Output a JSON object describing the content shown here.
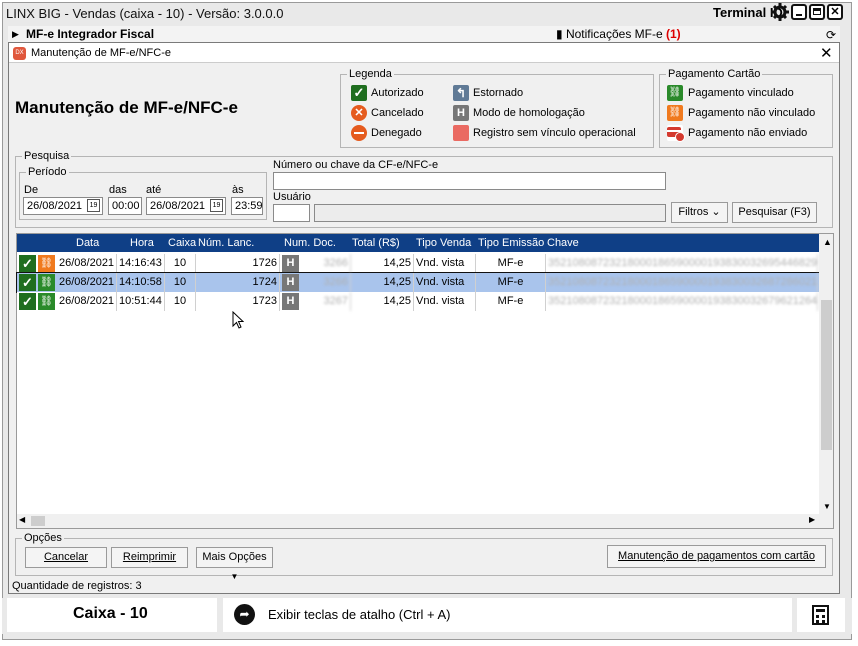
{
  "app": {
    "title": "LINX BIG - Vendas (caixa - 10) - Versão: 3.0.0.0",
    "terminal_label": "Terminal ID: 1"
  },
  "band": {
    "left_label": "MF-e Integrador Fiscal",
    "right_label": "Notificações MF-e",
    "right_count": "(1)"
  },
  "dialog": {
    "logo_text": "DX",
    "title": "Manutenção de MF-e/NFC-e",
    "heading": "Manutenção de MF-e/NFC-e"
  },
  "legenda": {
    "title": "Legenda",
    "items": [
      "Autorizado",
      "Cancelado",
      "Denegado",
      "Estornado",
      "Modo de homologação",
      "Registro sem vínculo operacional"
    ]
  },
  "pagamento": {
    "title": "Pagamento Cartão",
    "items": [
      "Pagamento vinculado",
      "Pagamento não vinculado",
      "Pagamento não enviado"
    ]
  },
  "pesquisa": {
    "title": "Pesquisa",
    "periodo_title": "Período",
    "de_label": "De",
    "das_label": "das",
    "ate_label": "até",
    "as_label": "às",
    "de_date": "26/08/2021",
    "das_time": "00:00",
    "ate_date": "26/08/2021",
    "as_time": "23:59",
    "numero_label": "Número ou chave da CF-e/NFC-e",
    "numero_value": "",
    "usuario_label": "Usuário",
    "usuario_code": "",
    "usuario_name": "",
    "filtros_label": "Filtros",
    "pesquisar_label": "Pesquisar (F3)"
  },
  "grid": {
    "columns": [
      "Data",
      "Hora",
      "Caixa",
      "Núm. Lanc.",
      "Num. Doc.",
      "Total (R$)",
      "Tipo Venda",
      "Tipo Emissão",
      "Chave"
    ],
    "rows": [
      {
        "data": "26/08/2021",
        "hora": "14:16:43",
        "caixa": "10",
        "lanc": "1726",
        "doc": "3266",
        "total": "14,25",
        "venda": "Vnd. vista",
        "emissao": "MF-e",
        "chave": "35210808723218000186590000193830032695446829",
        "pay": "nao-vinculado",
        "selected": false
      },
      {
        "data": "26/08/2021",
        "hora": "14:10:58",
        "caixa": "10",
        "lanc": "1724",
        "doc": "3266",
        "total": "14,25",
        "venda": "Vnd. vista",
        "emissao": "MF-e",
        "chave": "35210808723218000186590000193830032687286021",
        "pay": "vinculado",
        "selected": true
      },
      {
        "data": "26/08/2021",
        "hora": "10:51:44",
        "caixa": "10",
        "lanc": "1723",
        "doc": "3267",
        "total": "14,25",
        "venda": "Vnd. vista",
        "emissao": "MF-e",
        "chave": "35210808723218000186590000193830032679621264",
        "pay": "vinculado",
        "selected": false
      }
    ]
  },
  "opcoes": {
    "title": "Opções",
    "cancelar": "Cancelar",
    "reimprimir": "Reimprimir",
    "mais_opcoes": "Mais Opções",
    "manutencao_pag": "Manutenção de pagamentos com cartão"
  },
  "status": {
    "count_text": "Quantidade de registros: 3"
  },
  "footer": {
    "caixa": "Caixa - 10",
    "atalho": "Exibir teclas de atalho (Ctrl + A)"
  },
  "colors": {
    "header_blue": "#0f3f86",
    "selected_row": "#a9c4ec",
    "green": "#1f7a1f",
    "orange": "#f07a1e",
    "red_accent": "#d43a2f"
  }
}
